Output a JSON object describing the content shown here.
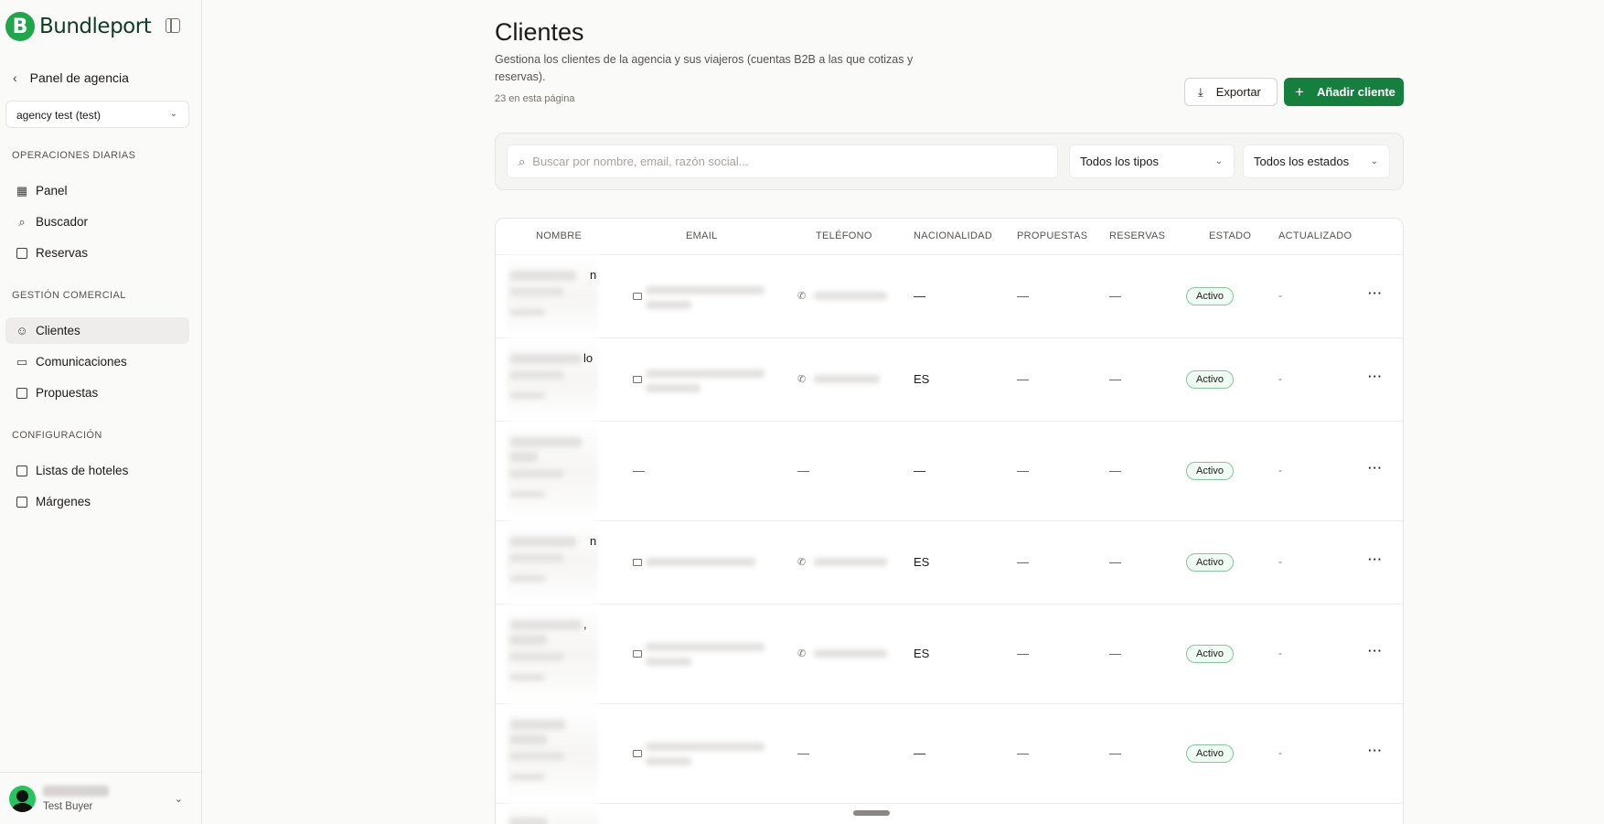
{
  "brand": {
    "name": "Bundleport",
    "mark": "B"
  },
  "sidebar": {
    "back_label": "Panel de agencia",
    "agency_select": "agency test (test)",
    "sections": [
      {
        "label": "OPERACIONES DIARIAS",
        "items": [
          {
            "label": "Panel",
            "icon": "dashboard-icon"
          },
          {
            "label": "Buscador",
            "icon": "search-icon"
          },
          {
            "label": "Reservas",
            "icon": "calendar-icon"
          }
        ]
      },
      {
        "label": "GESTIÓN COMERCIAL",
        "items": [
          {
            "label": "Clientes",
            "icon": "users-icon",
            "active": true
          },
          {
            "label": "Comunicaciones",
            "icon": "message-icon"
          },
          {
            "label": "Propuestas",
            "icon": "document-icon"
          }
        ]
      },
      {
        "label": "CONFIGURACIÓN",
        "items": [
          {
            "label": "Listas de hoteles",
            "icon": "bookmark-icon"
          },
          {
            "label": "Márgenes",
            "icon": "document-icon"
          }
        ]
      }
    ],
    "user": {
      "role": "Test Buyer"
    }
  },
  "header": {
    "title": "Clientes",
    "description": "Gestiona los clientes de la agencia y sus viajeros (cuentas B2B a las que cotizas y reservas).",
    "count": "23 en esta página",
    "export_label": "Exportar",
    "add_label": "Añadir cliente"
  },
  "filters": {
    "search_placeholder": "Buscar por nombre, email, razón social...",
    "type_select": "Todos los tipos",
    "status_select": "Todos los estados"
  },
  "table": {
    "columns": [
      "NOMBRE",
      "EMAIL",
      "TELÉFONO",
      "NACIONALIDAD",
      "PROPUESTAS",
      "RESERVAS",
      "ESTADO",
      "ACTUALIZADO"
    ],
    "rows": [
      {
        "name_tail": "n",
        "email_dash": "",
        "phone_dash": "",
        "nationality": "—",
        "proposals": "—",
        "bookings": "—",
        "status": "Activo",
        "updated": "-"
      },
      {
        "name_tail": "lo",
        "email_dash": "",
        "phone_dash": "",
        "nationality": "ES",
        "proposals": "—",
        "bookings": "—",
        "status": "Activo",
        "updated": "-"
      },
      {
        "name_tail": "",
        "email_dash": "—",
        "phone_dash": "—",
        "nationality": "—",
        "proposals": "—",
        "bookings": "—",
        "status": "Activo",
        "updated": "-"
      },
      {
        "name_tail": "n",
        "email_dash": "",
        "phone_dash": "",
        "nationality": "ES",
        "proposals": "—",
        "bookings": "—",
        "status": "Activo",
        "updated": "-"
      },
      {
        "name_tail": ",",
        "email_dash": "",
        "phone_dash": "",
        "nationality": "ES",
        "proposals": "—",
        "bookings": "—",
        "status": "Activo",
        "updated": "-"
      },
      {
        "name_tail": "",
        "email_dash": "",
        "phone_dash": "—",
        "nationality": "—",
        "proposals": "—",
        "bookings": "—",
        "status": "Activo",
        "updated": "-"
      }
    ]
  },
  "colors": {
    "brand_green": "#15803d",
    "logo_green": "#1fa64a",
    "badge_border": "#86c69a"
  }
}
